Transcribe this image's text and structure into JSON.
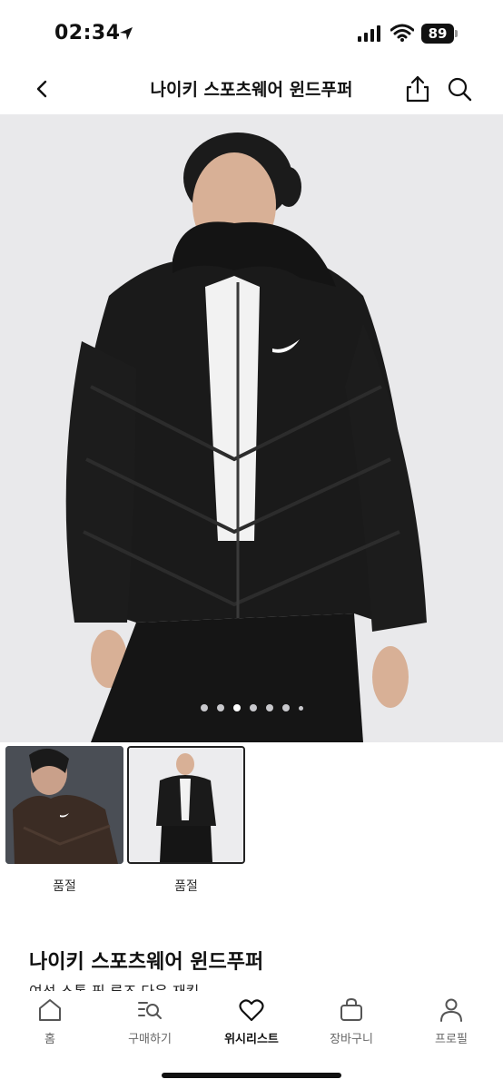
{
  "status_bar": {
    "time": "02:34",
    "battery": "89",
    "icons": [
      "location-arrow-icon",
      "cellular-signal-icon",
      "wifi-icon",
      "battery-icon"
    ]
  },
  "header": {
    "title": "나이키 스포츠웨어 윈드푸퍼",
    "icons": [
      "chevron-left-icon",
      "share-icon",
      "search-icon"
    ]
  },
  "gallery": {
    "page_count": 7,
    "active_index": 2
  },
  "thumbnails": [
    {
      "label": "품절",
      "selected": false,
      "color": "#3b2c24"
    },
    {
      "label": "품절",
      "selected": true,
      "color": "#111111"
    }
  ],
  "product": {
    "name": "나이키 스포츠웨어 윈드푸퍼",
    "subtitle": "여성 스톰 핏 루즈 다운 재킷"
  },
  "tabs": [
    {
      "label": "홈",
      "icon": "home-icon",
      "active": false
    },
    {
      "label": "구매하기",
      "icon": "search-list-icon",
      "active": false
    },
    {
      "label": "위시리스트",
      "icon": "heart-icon",
      "active": true
    },
    {
      "label": "장바구니",
      "icon": "bag-icon",
      "active": false
    },
    {
      "label": "프로필",
      "icon": "person-icon",
      "active": false
    }
  ],
  "colors": {
    "hero_background": "#e9e9eb",
    "jacket": "#1a1a1a",
    "text_primary": "#111111",
    "text_secondary": "#666666"
  }
}
